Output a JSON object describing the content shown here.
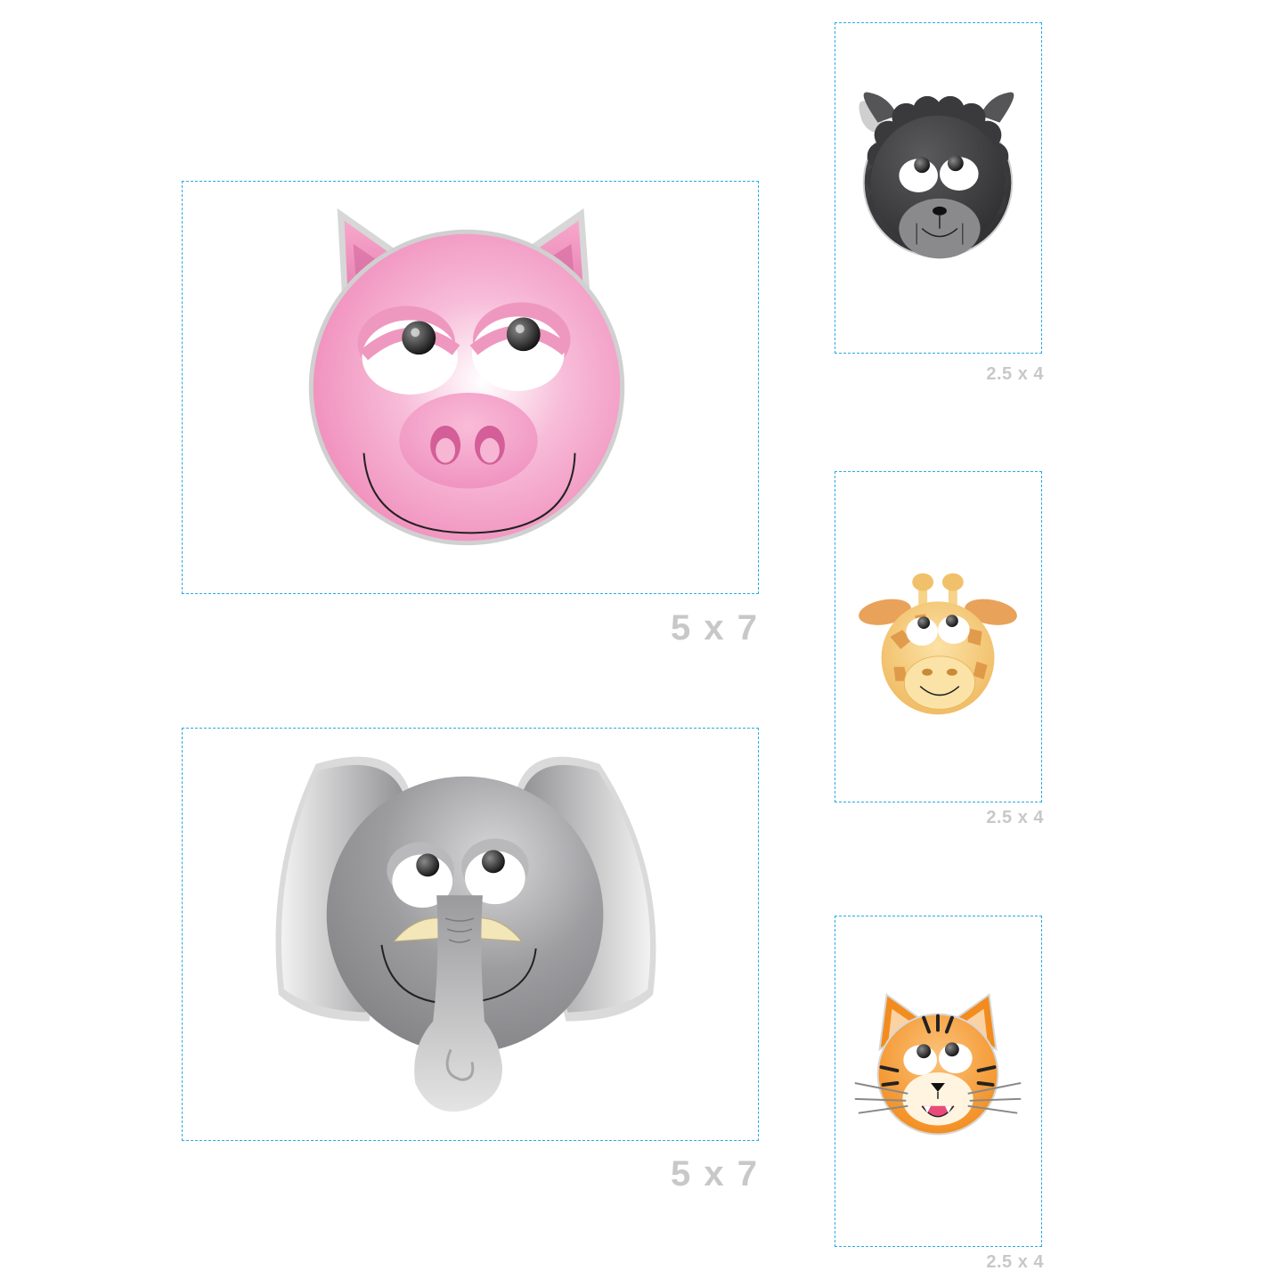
{
  "cards": [
    {
      "animal": "pig",
      "size_label": "5 x 7"
    },
    {
      "animal": "elephant",
      "size_label": "5 x 7"
    },
    {
      "animal": "sheep",
      "size_label": "2.5 x 4"
    },
    {
      "animal": "giraffe",
      "size_label": "2.5 x 4"
    },
    {
      "animal": "tiger",
      "size_label": "2.5 x 4"
    }
  ],
  "colors": {
    "frame_border": "#29abe2",
    "label_text": "#c8c8c8",
    "pig_pink": "#f29ac4",
    "elephant_gray": "#8e8e92",
    "sheep_dark": "#3a3a3c",
    "giraffe_yellow": "#f8d48a",
    "tiger_orange": "#f7941d"
  }
}
